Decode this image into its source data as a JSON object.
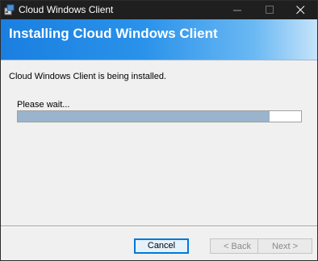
{
  "window": {
    "title": "Cloud Windows Client",
    "controls": {
      "minimize_icon": "minimize-icon",
      "maximize_icon": "maximize-icon",
      "close_icon": "close-icon"
    }
  },
  "banner": {
    "title": "Installing Cloud Windows Client"
  },
  "body": {
    "status": "Cloud Windows Client is being installed.",
    "wait_label": "Please wait...",
    "progress": 0.89
  },
  "buttons": {
    "cancel": "Cancel",
    "back": "< Back",
    "next": "Next >"
  },
  "colors": {
    "accent": "#0078d7",
    "banner_start": "#1a7fe0",
    "progress_fill": "#9ab4cd"
  }
}
